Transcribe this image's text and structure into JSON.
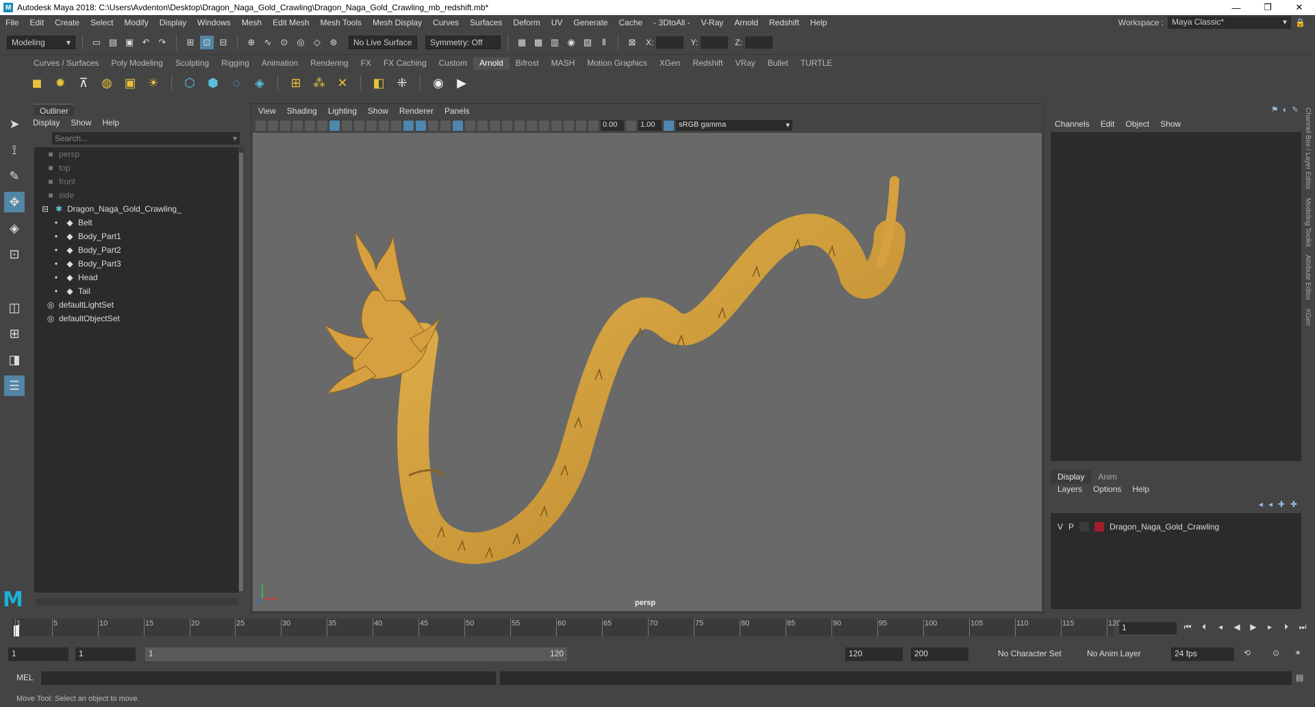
{
  "window": {
    "title": "Autodesk Maya 2018: C:\\Users\\Avdenton\\Desktop\\Dragon_Naga_Gold_Crawling\\Dragon_Naga_Gold_Crawling_mb_redshift.mb*",
    "app_icon": "M"
  },
  "menubar": {
    "items": [
      "File",
      "Edit",
      "Create",
      "Select",
      "Modify",
      "Display",
      "Windows",
      "Mesh",
      "Edit Mesh",
      "Mesh Tools",
      "Mesh Display",
      "Curves",
      "Surfaces",
      "Deform",
      "UV",
      "Generate",
      "Cache",
      "- 3DtoAll -",
      "V-Ray",
      "Arnold",
      "Redshift",
      "Help"
    ],
    "workspace_label": "Workspace :",
    "workspace_value": "Maya Classic*"
  },
  "statusline": {
    "mode": "Modeling",
    "live_surface": "No Live Surface",
    "symmetry": "Symmetry: Off",
    "x_label": "X:",
    "y_label": "Y:",
    "z_label": "Z:"
  },
  "shelf": {
    "tabs": [
      "Curves / Surfaces",
      "Poly Modeling",
      "Sculpting",
      "Rigging",
      "Animation",
      "Rendering",
      "FX",
      "FX Caching",
      "Custom",
      "Arnold",
      "Bifrost",
      "MASH",
      "Motion Graphics",
      "XGen",
      "Redshift",
      "VRay",
      "Bullet",
      "TURTLE"
    ],
    "active_tab": "Arnold"
  },
  "outliner": {
    "tab": "Outliner",
    "menus": [
      "Display",
      "Show",
      "Help"
    ],
    "search_placeholder": "Search...",
    "items": [
      {
        "label": "persp",
        "dim": true,
        "icon": "camera-icon",
        "indent": 1
      },
      {
        "label": "top",
        "dim": true,
        "icon": "camera-icon",
        "indent": 1
      },
      {
        "label": "front",
        "dim": true,
        "icon": "camera-icon",
        "indent": 1
      },
      {
        "label": "side",
        "dim": true,
        "icon": "camera-icon",
        "indent": 1
      },
      {
        "label": "Dragon_Naga_Gold_Crawling_",
        "dim": false,
        "icon": "group-icon",
        "indent": 0
      },
      {
        "label": "Belt",
        "dim": false,
        "icon": "mesh-icon",
        "indent": 2
      },
      {
        "label": "Body_Part1",
        "dim": false,
        "icon": "mesh-icon",
        "indent": 2
      },
      {
        "label": "Body_Part2",
        "dim": false,
        "icon": "mesh-icon",
        "indent": 2
      },
      {
        "label": "Body_Part3",
        "dim": false,
        "icon": "mesh-icon",
        "indent": 2
      },
      {
        "label": "Head",
        "dim": false,
        "icon": "mesh-icon",
        "indent": 2
      },
      {
        "label": "Tail",
        "dim": false,
        "icon": "mesh-icon",
        "indent": 2
      },
      {
        "label": "defaultLightSet",
        "dim": false,
        "icon": "set-icon",
        "indent": 1
      },
      {
        "label": "defaultObjectSet",
        "dim": false,
        "icon": "set-icon",
        "indent": 1
      }
    ]
  },
  "viewport": {
    "menus": [
      "View",
      "Shading",
      "Lighting",
      "Show",
      "Renderer",
      "Panels"
    ],
    "exposure": "0.00",
    "gamma": "1.00",
    "color_space": "sRGB gamma",
    "camera_label": "persp",
    "model_color": "#d6a040"
  },
  "channelbox": {
    "menus": [
      "Channels",
      "Edit",
      "Object",
      "Show"
    ],
    "layer_tabs": [
      "Display",
      "Anim"
    ],
    "layer_menus": [
      "Layers",
      "Options",
      "Help"
    ],
    "layer": {
      "v": "V",
      "p": "P",
      "name": "Dragon_Naga_Gold_Crawling",
      "color": "#a01e2e"
    },
    "side_tabs": [
      "Channel Box / Layer Editor",
      "Modeling Toolkit",
      "Attribute Editor",
      "XGen"
    ]
  },
  "timeslider": {
    "ticks": [
      "1",
      "5",
      "10",
      "15",
      "20",
      "25",
      "30",
      "35",
      "40",
      "45",
      "50",
      "55",
      "60",
      "65",
      "70",
      "75",
      "80",
      "85",
      "90",
      "95",
      "100",
      "105",
      "110",
      "115",
      "120"
    ],
    "current_frame": "1"
  },
  "range": {
    "start": "1",
    "playback_start": "1",
    "range_start": "1",
    "range_end": "120",
    "playback_end": "120",
    "end": "200",
    "character_set": "No Character Set",
    "anim_layer": "No Anim Layer",
    "fps": "24 fps"
  },
  "cmdline": {
    "label": "MEL"
  },
  "helpline": {
    "text": "Move Tool: Select an object to move."
  }
}
